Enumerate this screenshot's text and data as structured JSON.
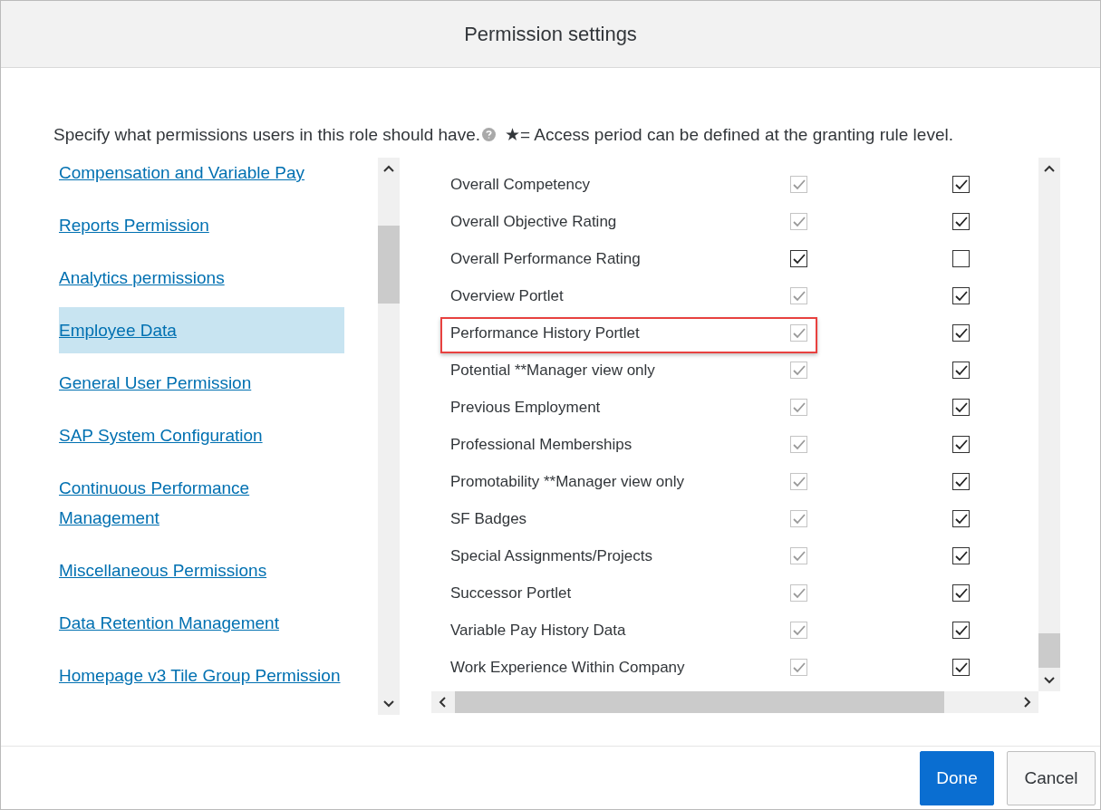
{
  "dialog": {
    "title": "Permission settings"
  },
  "description": "Specify what permissions users in this role should have.",
  "note": "★= Access period can be defined at the granting rule level.",
  "categories": [
    {
      "label": "Compensation and Variable Pay",
      "selected": false
    },
    {
      "label": "Reports Permission",
      "selected": false
    },
    {
      "label": "Analytics permissions",
      "selected": false
    },
    {
      "label": "Employee Data",
      "selected": true
    },
    {
      "label": "General User Permission",
      "selected": false
    },
    {
      "label": "SAP System Configuration",
      "selected": false
    },
    {
      "label": "Continuous Performance Management",
      "selected": false
    },
    {
      "label": "Miscellaneous Permissions",
      "selected": false
    },
    {
      "label": "Data Retention Management",
      "selected": false
    },
    {
      "label": "Homepage v3 Tile Group Permission",
      "selected": false
    }
  ],
  "permissions": [
    {
      "label": "Overall Competency",
      "highlighted": false,
      "view": {
        "checked": true,
        "disabled": true
      },
      "edit": {
        "checked": true,
        "disabled": false
      }
    },
    {
      "label": "Overall Objective Rating",
      "highlighted": false,
      "view": {
        "checked": true,
        "disabled": true
      },
      "edit": {
        "checked": true,
        "disabled": false
      }
    },
    {
      "label": "Overall Performance Rating",
      "highlighted": false,
      "view": {
        "checked": true,
        "disabled": false
      },
      "edit": {
        "checked": false,
        "disabled": false
      }
    },
    {
      "label": "Overview Portlet",
      "highlighted": false,
      "view": {
        "checked": true,
        "disabled": true
      },
      "edit": {
        "checked": true,
        "disabled": false
      }
    },
    {
      "label": "Performance History Portlet",
      "highlighted": true,
      "view": {
        "checked": true,
        "disabled": true
      },
      "edit": {
        "checked": true,
        "disabled": false
      }
    },
    {
      "label": "Potential **Manager view only",
      "highlighted": false,
      "view": {
        "checked": true,
        "disabled": true
      },
      "edit": {
        "checked": true,
        "disabled": false
      }
    },
    {
      "label": "Previous Employment",
      "highlighted": false,
      "view": {
        "checked": true,
        "disabled": true
      },
      "edit": {
        "checked": true,
        "disabled": false
      }
    },
    {
      "label": "Professional Memberships",
      "highlighted": false,
      "view": {
        "checked": true,
        "disabled": true
      },
      "edit": {
        "checked": true,
        "disabled": false
      }
    },
    {
      "label": "Promotability **Manager view only",
      "highlighted": false,
      "view": {
        "checked": true,
        "disabled": true
      },
      "edit": {
        "checked": true,
        "disabled": false
      }
    },
    {
      "label": "SF Badges",
      "highlighted": false,
      "view": {
        "checked": true,
        "disabled": true
      },
      "edit": {
        "checked": true,
        "disabled": false
      }
    },
    {
      "label": "Special Assignments/Projects",
      "highlighted": false,
      "view": {
        "checked": true,
        "disabled": true
      },
      "edit": {
        "checked": true,
        "disabled": false
      }
    },
    {
      "label": "Successor Portlet",
      "highlighted": false,
      "view": {
        "checked": true,
        "disabled": true
      },
      "edit": {
        "checked": true,
        "disabled": false
      }
    },
    {
      "label": "Variable Pay History Data",
      "highlighted": false,
      "view": {
        "checked": true,
        "disabled": true
      },
      "edit": {
        "checked": true,
        "disabled": false
      }
    },
    {
      "label": "Work Experience Within Company",
      "highlighted": false,
      "view": {
        "checked": true,
        "disabled": true
      },
      "edit": {
        "checked": true,
        "disabled": false
      }
    }
  ],
  "buttons": [
    {
      "label": "Done",
      "kind": "primary"
    },
    {
      "label": "Cancel",
      "kind": "secondary"
    }
  ]
}
